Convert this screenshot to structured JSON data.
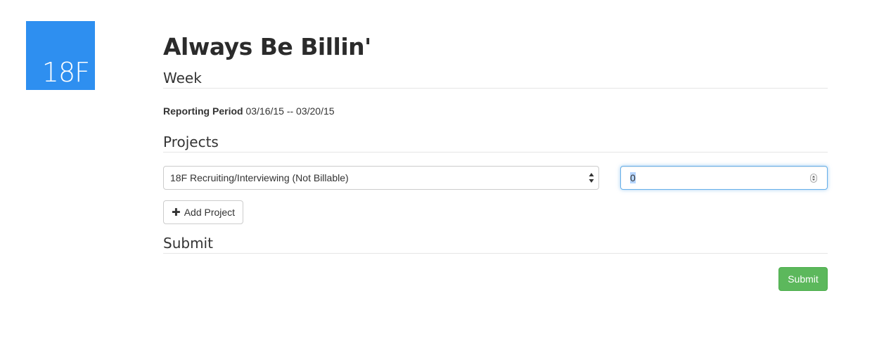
{
  "logo": {
    "text": "18F",
    "color": "#2e8ff0"
  },
  "header": {
    "title": "Always Be Billin'"
  },
  "week": {
    "heading": "Week",
    "reporting_label": "Reporting Period",
    "reporting_value": "03/16/15 -- 03/20/15"
  },
  "projects": {
    "heading": "Projects",
    "selected_project": "18F Recruiting/Interviewing (Not Billable)",
    "hours_value": "0",
    "add_project_label": "Add Project",
    "add_icon": "plus-icon"
  },
  "submit": {
    "heading": "Submit",
    "button_label": "Submit",
    "button_color": "#5cb85c"
  }
}
